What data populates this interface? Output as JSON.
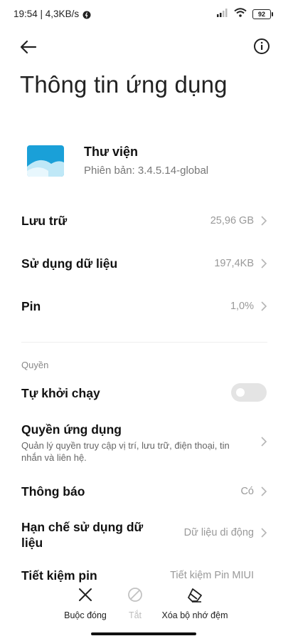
{
  "status_bar": {
    "time_speed": "19:54 | 4,3KB/s",
    "battery": "92"
  },
  "page": {
    "title": "Thông tin ứng dụng"
  },
  "app": {
    "name": "Thư viện",
    "version": "Phiên bản: 3.4.5.14-global"
  },
  "rows": {
    "storage": {
      "label": "Lưu trữ",
      "value": "25,96 GB"
    },
    "data_usage": {
      "label": "Sử dụng dữ liệu",
      "value": "197,4KB"
    },
    "battery": {
      "label": "Pin",
      "value": "1,0%"
    }
  },
  "permissions": {
    "section_label": "Quyền",
    "autostart": {
      "label": "Tự khởi chạy",
      "enabled": false
    },
    "app_permissions": {
      "label": "Quyền ứng dụng",
      "description": "Quản lý quyền truy cập vị trí, lưu trữ, điện thoại, tin nhắn và liên hệ."
    },
    "notifications": {
      "label": "Thông báo",
      "value": "Có"
    },
    "restrict_data": {
      "label": "Hạn chế sử dụng dữ liệu",
      "value": "Dữ liệu di động"
    },
    "partial_row": {
      "label": "Tiết kiệm pin",
      "value": "Tiết kiệm Pin MIUI"
    }
  },
  "actions": {
    "force_stop": "Buộc đóng",
    "disable": "Tắt",
    "clear_cache": "Xóa bộ nhớ đệm"
  },
  "colors": {
    "accent_icon_top": "#1aa0d8",
    "accent_icon_bottom": "#bfe8f7",
    "chevron": "#b5b5b5"
  }
}
